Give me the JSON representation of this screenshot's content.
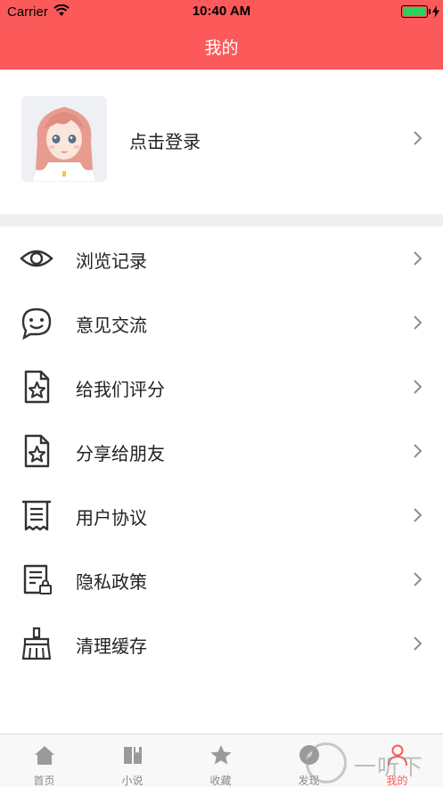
{
  "status_bar": {
    "carrier": "Carrier",
    "time": "10:40 AM",
    "icons": {
      "wifi": "wifi-icon",
      "battery": "battery-icon",
      "charging": "charging-bolt-icon"
    }
  },
  "header": {
    "title": "我的"
  },
  "profile": {
    "login_label": "点击登录",
    "avatar_icon": "anime-girl-avatar"
  },
  "menu": {
    "items": [
      {
        "label": "浏览记录",
        "icon": "eye-icon"
      },
      {
        "label": "意见交流",
        "icon": "chat-bubble-smile-icon"
      },
      {
        "label": "给我们评分",
        "icon": "document-star-icon"
      },
      {
        "label": "分享给朋友",
        "icon": "document-star-icon"
      },
      {
        "label": "用户协议",
        "icon": "receipt-icon"
      },
      {
        "label": "隐私政策",
        "icon": "document-lock-icon"
      },
      {
        "label": "清理缓存",
        "icon": "broom-icon"
      }
    ]
  },
  "tabbar": {
    "tabs": [
      {
        "label": "首页",
        "icon": "home-icon",
        "active": false
      },
      {
        "label": "小说",
        "icon": "book-icon",
        "active": false
      },
      {
        "label": "收藏",
        "icon": "star-icon",
        "active": false
      },
      {
        "label": "发现",
        "icon": "compass-icon",
        "active": false
      },
      {
        "label": "我的",
        "icon": "person-icon",
        "active": true
      }
    ]
  },
  "watermark": {
    "text": "一听下载",
    "glyph": "听"
  },
  "colors": {
    "accent": "#fc5a5a",
    "tab_inactive": "#8a8a8a",
    "battery": "#2bd15a",
    "divider": "#efeff1"
  }
}
